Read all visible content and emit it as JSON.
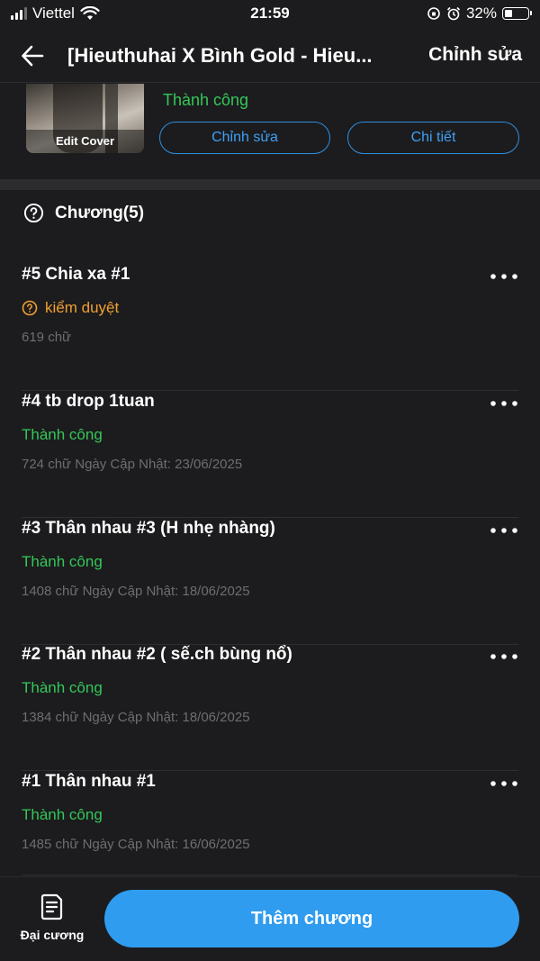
{
  "status_bar": {
    "carrier": "Viettel",
    "time": "21:59",
    "battery": "32%",
    "battery_level": 0.32
  },
  "header": {
    "title": "[Hieuthuhai X Bình Gold - Hieu...",
    "edit_label": "Chỉnh sửa",
    "back_icon": "arrow-left-icon"
  },
  "story": {
    "cover_label": "Edit Cover",
    "status": "Thành công",
    "edit_button": "Chỉnh sửa",
    "detail_button": "Chi tiết"
  },
  "chapters": {
    "title": "Chương(5)",
    "items": [
      {
        "title": "#5 Chia xa #1",
        "status": "kiểm duyệt",
        "status_type": "review",
        "meta": "619 chữ"
      },
      {
        "title": "#4 tb drop 1tuan",
        "status": "Thành công",
        "status_type": "success",
        "meta": "724 chữ Ngày Cập Nhật: 23/06/2025"
      },
      {
        "title": "#3 Thân nhau #3 (H nhẹ nhàng)",
        "status": "Thành công",
        "status_type": "success",
        "meta": "1408 chữ Ngày Cập Nhật: 18/06/2025"
      },
      {
        "title": "#2 Thân nhau #2 ( sế.ch bùng nổ)",
        "status": "Thành công",
        "status_type": "success",
        "meta": "1384 chữ Ngày Cập Nhật: 18/06/2025"
      },
      {
        "title": "#1 Thân nhau #1",
        "status": "Thành công",
        "status_type": "success",
        "meta": "1485 chữ Ngày Cập Nhật: 16/06/2025"
      }
    ]
  },
  "bottom": {
    "outline_label": "Đại cương",
    "add_chapter": "Thêm chương"
  },
  "colors": {
    "background": "#1c1c1e",
    "success": "#34c759",
    "review": "#f0a030",
    "accent": "#2f9cf0"
  }
}
